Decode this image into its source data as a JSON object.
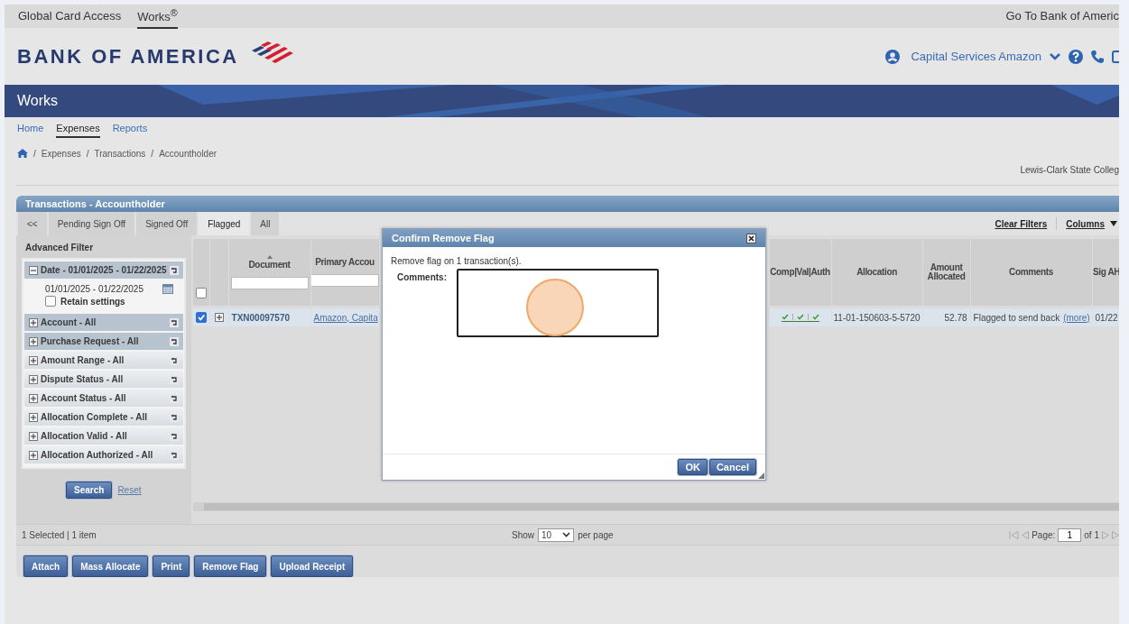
{
  "top_bar": {
    "links": [
      {
        "label": "Global Card Access",
        "selected": false
      },
      {
        "label": "Works$^{®}$",
        "selected": true
      }
    ],
    "right_link": "Go To Bank of Americ"
  },
  "header": {
    "logo": "BANK OF AMERICA",
    "user": "Capital Services Amazon"
  },
  "banner": {
    "title": "Works"
  },
  "nav": [
    {
      "label": "Home",
      "selected": false
    },
    {
      "label": "Expenses",
      "selected": true
    },
    {
      "label": "Reports",
      "selected": false
    }
  ],
  "breadcrumb": [
    {
      "separator": "/",
      "label": "Expenses"
    },
    {
      "separator": "/",
      "label": "Transactions"
    },
    {
      "separator": "/",
      "label": "Accountholder"
    }
  ],
  "organization": "Lewis-Clark State Colleg",
  "panel": {
    "title": "Transactions - Accountholder",
    "tabs": [
      {
        "label": "<<",
        "selected": false
      },
      {
        "label": "Pending Sign Off",
        "selected": false
      },
      {
        "label": "Signed Off",
        "selected": false
      },
      {
        "label": "Flagged",
        "selected": true
      },
      {
        "label": "All",
        "selected": false
      }
    ],
    "actions": [
      "Clear Filters",
      "Columns"
    ],
    "filter": {
      "title": "Advanced Filter",
      "groups": [
        {
          "label": "Date - 01/01/2025 - 01/22/2025",
          "expanded": true,
          "highlighted": true,
          "range": "01/01/2025 - 01/22/2025",
          "retain": {
            "label": "Retain settings",
            "checked": false
          }
        },
        {
          "label": "Account - All",
          "expanded": false,
          "highlighted": true
        },
        {
          "label": "Purchase Request - All",
          "expanded": false,
          "highlighted": true
        },
        {
          "label": "Amount Range - All",
          "expanded": false,
          "highlighted": false
        },
        {
          "label": "Dispute Status - All",
          "expanded": false,
          "highlighted": false
        },
        {
          "label": "Account Status - All",
          "expanded": false,
          "highlighted": false
        },
        {
          "label": "Allocation Complete - All",
          "expanded": false,
          "highlighted": false
        },
        {
          "label": "Allocation Valid - All",
          "expanded": false,
          "highlighted": false
        },
        {
          "label": "Allocation Authorized - All",
          "expanded": false,
          "highlighted": false
        }
      ],
      "search": "Search",
      "reset": "Reset"
    },
    "table": {
      "select_all": {
        "checked": false
      },
      "columns": [
        {
          "label": "Document",
          "sorted": true,
          "filter": true
        },
        {
          "label": "Primary Accou",
          "sorted": false,
          "filter": true
        },
        {
          "label": "Comp|Val|Auth",
          "sorted": false,
          "filter": false
        },
        {
          "label": "Allocation",
          "sorted": false,
          "filter": false
        },
        {
          "label": "Amount Allocated",
          "sorted": false,
          "filter": false
        },
        {
          "label": "Comments",
          "sorted": false,
          "filter": false
        },
        {
          "label": "Sig AH",
          "sorted": false,
          "filter": false
        }
      ],
      "rows": [
        {
          "selected": true,
          "document": "TXN00097570",
          "account": "Amazon, Capita",
          "complete": true,
          "valid": true,
          "authorized": true,
          "allocation": "11-01-150603-5-5720",
          "amount": "52.78",
          "comment": "Flagged to send back",
          "more": "(more)",
          "sig": "01/22"
        }
      ]
    },
    "status": "1 Selected | 1 item",
    "pager": {
      "show": "Show",
      "per_page_value": "10",
      "per_page": "per page",
      "page_label": "Page:",
      "page": "1",
      "of": "of 1"
    },
    "buttons": [
      "Attach",
      "Mass Allocate",
      "Print",
      "Remove Flag",
      "Upload Receipt"
    ]
  },
  "dialog": {
    "title": "Confirm Remove Flag",
    "message": "Remove flag on 1 transaction(s).",
    "comments_label": "Comments:",
    "buttons": [
      "OK",
      "Cancel"
    ]
  }
}
